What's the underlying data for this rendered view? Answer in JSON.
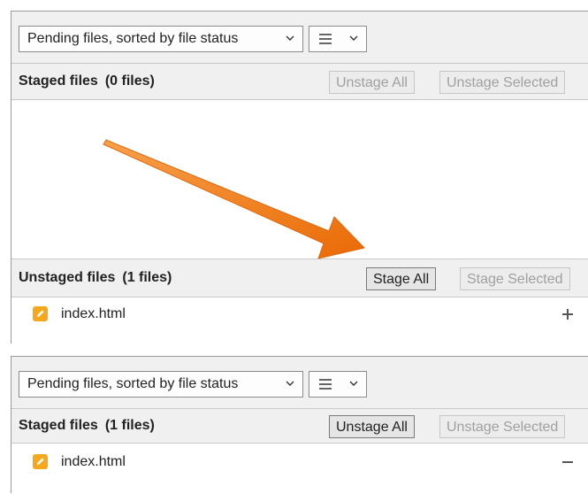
{
  "colors": {
    "accent": "#f07a10",
    "file_icon": "#f5a81c"
  },
  "panel1": {
    "toolbar": {
      "sort_dropdown": "Pending files, sorted by file status",
      "view_icon": "list-view-icon"
    },
    "staged": {
      "title": "Staged files",
      "count": "(0 files)",
      "unstage_all": "Unstage All",
      "unstage_selected": "Unstage Selected"
    },
    "unstaged": {
      "title": "Unstaged files",
      "count": "(1 files)",
      "stage_all": "Stage All",
      "stage_selected": "Stage Selected",
      "files": [
        {
          "name": "index.html",
          "icon": "edit-file-icon",
          "action_icon": "plus-icon"
        }
      ]
    }
  },
  "panel2": {
    "toolbar": {
      "sort_dropdown": "Pending files, sorted by file status",
      "view_icon": "list-view-icon"
    },
    "staged": {
      "title": "Staged files",
      "count": "(1 files)",
      "unstage_all": "Unstage All",
      "unstage_selected": "Unstage Selected",
      "files": [
        {
          "name": "index.html",
          "icon": "edit-file-icon",
          "action_icon": "minus-icon"
        }
      ]
    }
  }
}
